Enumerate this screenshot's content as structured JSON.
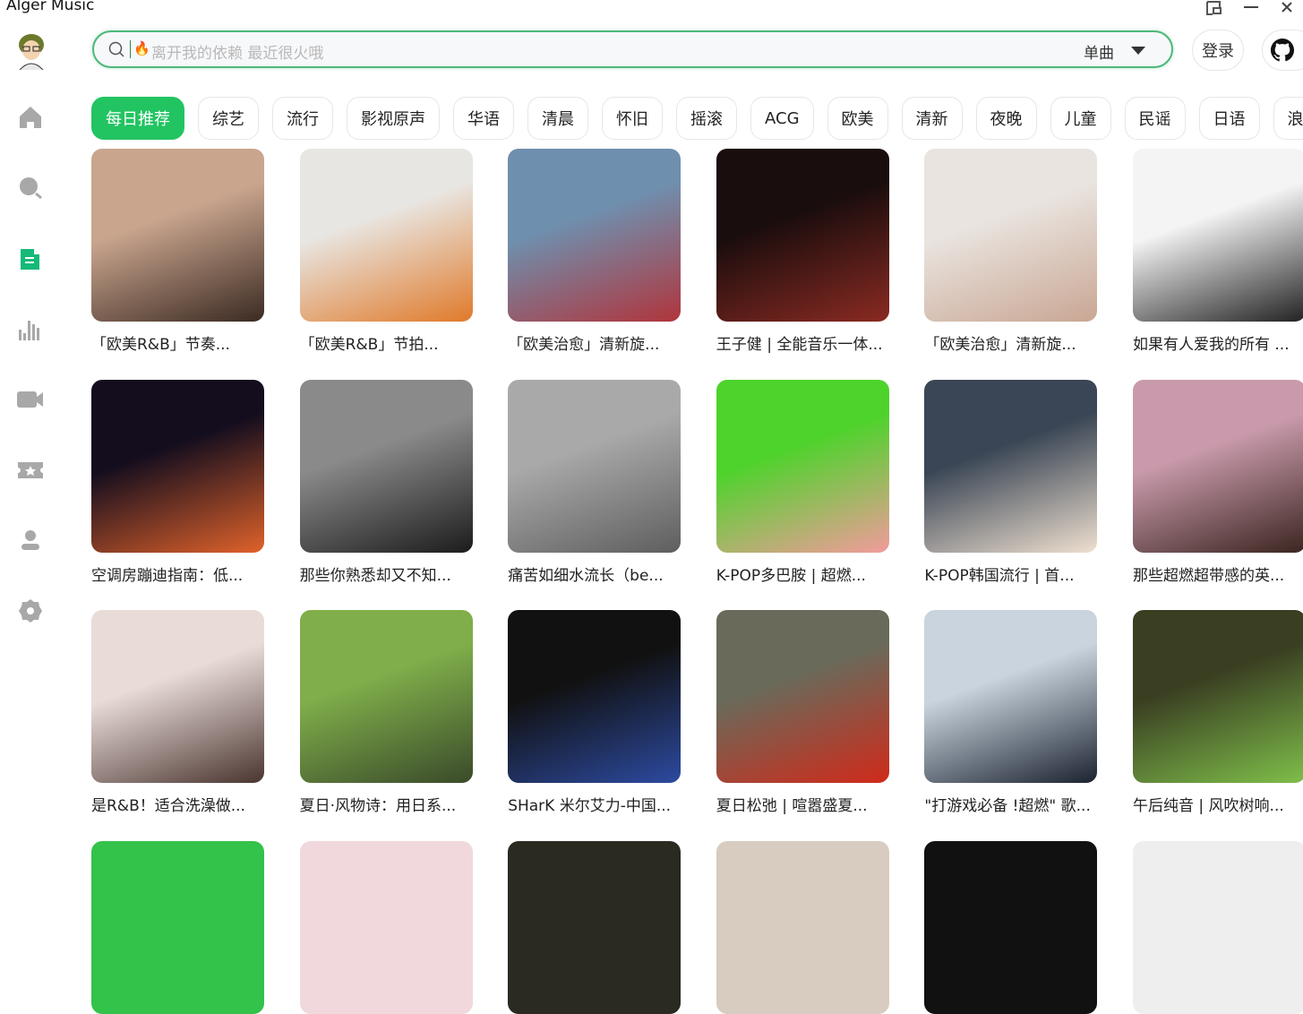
{
  "app": {
    "title": "Alger Music"
  },
  "window_controls": [
    "restore",
    "minimize",
    "close"
  ],
  "sidebar": {
    "items": [
      {
        "id": "home",
        "icon": "home-icon"
      },
      {
        "id": "search",
        "icon": "search-icon"
      },
      {
        "id": "playlist",
        "icon": "document-icon",
        "active": true
      },
      {
        "id": "charts",
        "icon": "bar-chart-icon"
      },
      {
        "id": "mv",
        "icon": "video-icon"
      },
      {
        "id": "ticket",
        "icon": "ticket-icon"
      },
      {
        "id": "user",
        "icon": "user-icon"
      },
      {
        "id": "settings",
        "icon": "gear-icon"
      }
    ]
  },
  "search": {
    "placeholder": "离开我的依赖 最近很火哦",
    "type": "单曲"
  },
  "header": {
    "login": "登录"
  },
  "accent": "#22c462",
  "tags": [
    "每日推荐",
    "综艺",
    "流行",
    "影视原声",
    "华语",
    "清晨",
    "怀旧",
    "摇滚",
    "ACG",
    "欧美",
    "清新",
    "夜晚",
    "儿童",
    "民谣",
    "日语",
    "浪漫"
  ],
  "playlists": [
    {
      "title": "「欧美R&B」节奏...",
      "c1": "#c9a58e",
      "c2": "#3b2a22"
    },
    {
      "title": "「欧美R&B」节拍...",
      "c1": "#e8e6e2",
      "c2": "#e07a2a"
    },
    {
      "title": "「欧美治愈」清新旋...",
      "c1": "#6f8fae",
      "c2": "#b0353c"
    },
    {
      "title": "王子健 | 全能音乐一体...",
      "c1": "#1a0d0d",
      "c2": "#8a2a22"
    },
    {
      "title": "「欧美治愈」清新旋...",
      "c1": "#e9e4df",
      "c2": "#c9a693"
    },
    {
      "title": "如果有人爱我的所有 ...",
      "c1": "#f4f4f4",
      "c2": "#222222"
    },
    {
      "title": "空调房蹦迪指南：低...",
      "c1": "#130d1e",
      "c2": "#e0622a"
    },
    {
      "title": "那些你熟悉却又不知...",
      "c1": "#8a8a8a",
      "c2": "#1c1c1c"
    },
    {
      "title": "痛苦如细水流长（be...",
      "c1": "#a9a9a9",
      "c2": "#5e5e5e"
    },
    {
      "title": "K-POP多巴胺 | 超燃...",
      "c1": "#4dd32b",
      "c2": "#f29b9b"
    },
    {
      "title": "K-POP韩国流行 | 首...",
      "c1": "#3a4655",
      "c2": "#efe0d0"
    },
    {
      "title": "那些超燃超带感的英...",
      "c1": "#c99aab",
      "c2": "#3a2520"
    },
    {
      "title": "是R&B！适合洗澡做...",
      "c1": "#e9dcd8",
      "c2": "#4a3530"
    },
    {
      "title": "夏日·风物诗：用日系...",
      "c1": "#7fae4a",
      "c2": "#3a4a2a"
    },
    {
      "title": "SHarK 米尔艾力-中国...",
      "c1": "#111111",
      "c2": "#2c4aa0"
    },
    {
      "title": "夏日松弛 | 喧嚣盛夏...",
      "c1": "#6a6a5a",
      "c2": "#d02a1a"
    },
    {
      "title": "\"打游戏必备 !超燃\" 歌...",
      "c1": "#c9d4de",
      "c2": "#1b2330"
    },
    {
      "title": "午后纯音 | 风吹树响...",
      "c1": "#3a3f22",
      "c2": "#7fbf4a"
    },
    {
      "title": "",
      "c1": "#33c24a",
      "c2": "#33c24a"
    },
    {
      "title": "",
      "c1": "#f0d8dc",
      "c2": "#f0d8dc"
    },
    {
      "title": "",
      "c1": "#2a2a20",
      "c2": "#2a2a20"
    },
    {
      "title": "",
      "c1": "#d8ccc0",
      "c2": "#d8ccc0"
    },
    {
      "title": "",
      "c1": "#111",
      "c2": "#111"
    },
    {
      "title": "",
      "c1": "#eee",
      "c2": "#eee"
    }
  ]
}
